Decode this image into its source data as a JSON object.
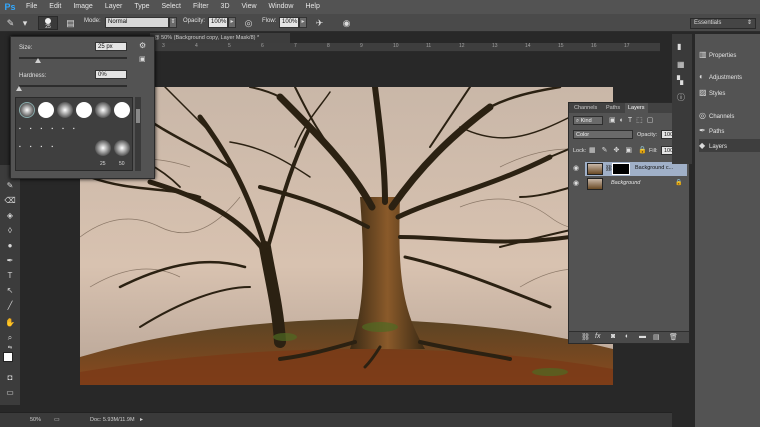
{
  "app": {
    "logo": "Ps"
  },
  "menu": [
    "File",
    "Edit",
    "Image",
    "Layer",
    "Type",
    "Select",
    "Filter",
    "3D",
    "View",
    "Window",
    "Help"
  ],
  "options": {
    "brush_size": "25",
    "mode_label": "Mode:",
    "mode_value": "Normal",
    "opacity_label": "Opacity:",
    "opacity_value": "100%",
    "flow_label": "Flow:",
    "flow_value": "100%"
  },
  "workspace": {
    "name": "Essentials"
  },
  "document": {
    "tab_title": "@ 50% (Background copy, Layer Mask/8) *",
    "ruler_ticks": [
      "3",
      "4",
      "5",
      "6",
      "7",
      "8",
      "9",
      "10",
      "11",
      "12",
      "13",
      "14",
      "15",
      "16",
      "17"
    ]
  },
  "brush_picker": {
    "size_label": "Size:",
    "size_value": "25 px",
    "hardness_label": "Hardness:",
    "hardness_value": "0%",
    "size_fraction": 0.18,
    "hardness_fraction": 0.0,
    "preset_labels": [
      "25",
      "50"
    ]
  },
  "layers_panel": {
    "tabs": [
      "Channels",
      "Paths",
      "Layers"
    ],
    "active_tab": "Layers",
    "filter_kind": "Kind",
    "blend_mode": "Color",
    "opacity_label": "Opacity:",
    "opacity_value": "100%",
    "lock_label": "Lock:",
    "fill_label": "Fill:",
    "fill_value": "100%",
    "layers": [
      {
        "name": "Background c...",
        "selected": true,
        "has_mask": true,
        "locked": false
      },
      {
        "name": "Background",
        "selected": false,
        "has_mask": false,
        "locked": true
      }
    ]
  },
  "dock": {
    "items": [
      {
        "icon": "properties-icon",
        "label": "Properties"
      },
      {
        "icon": "adjustments-icon",
        "label": "Adjustments"
      },
      {
        "icon": "styles-icon",
        "label": "Styles"
      },
      {
        "icon": "channels-icon",
        "label": "Channels"
      },
      {
        "icon": "paths-icon",
        "label": "Paths"
      },
      {
        "icon": "layers-icon",
        "label": "Layers"
      }
    ]
  },
  "status": {
    "zoom": "50%",
    "doc_size": "Doc: 5.93M/11.9M"
  },
  "colors": {
    "accent_logo": "#31a8ff",
    "selected_layer": "#a0b0c8",
    "ui_panel": "#535353"
  }
}
